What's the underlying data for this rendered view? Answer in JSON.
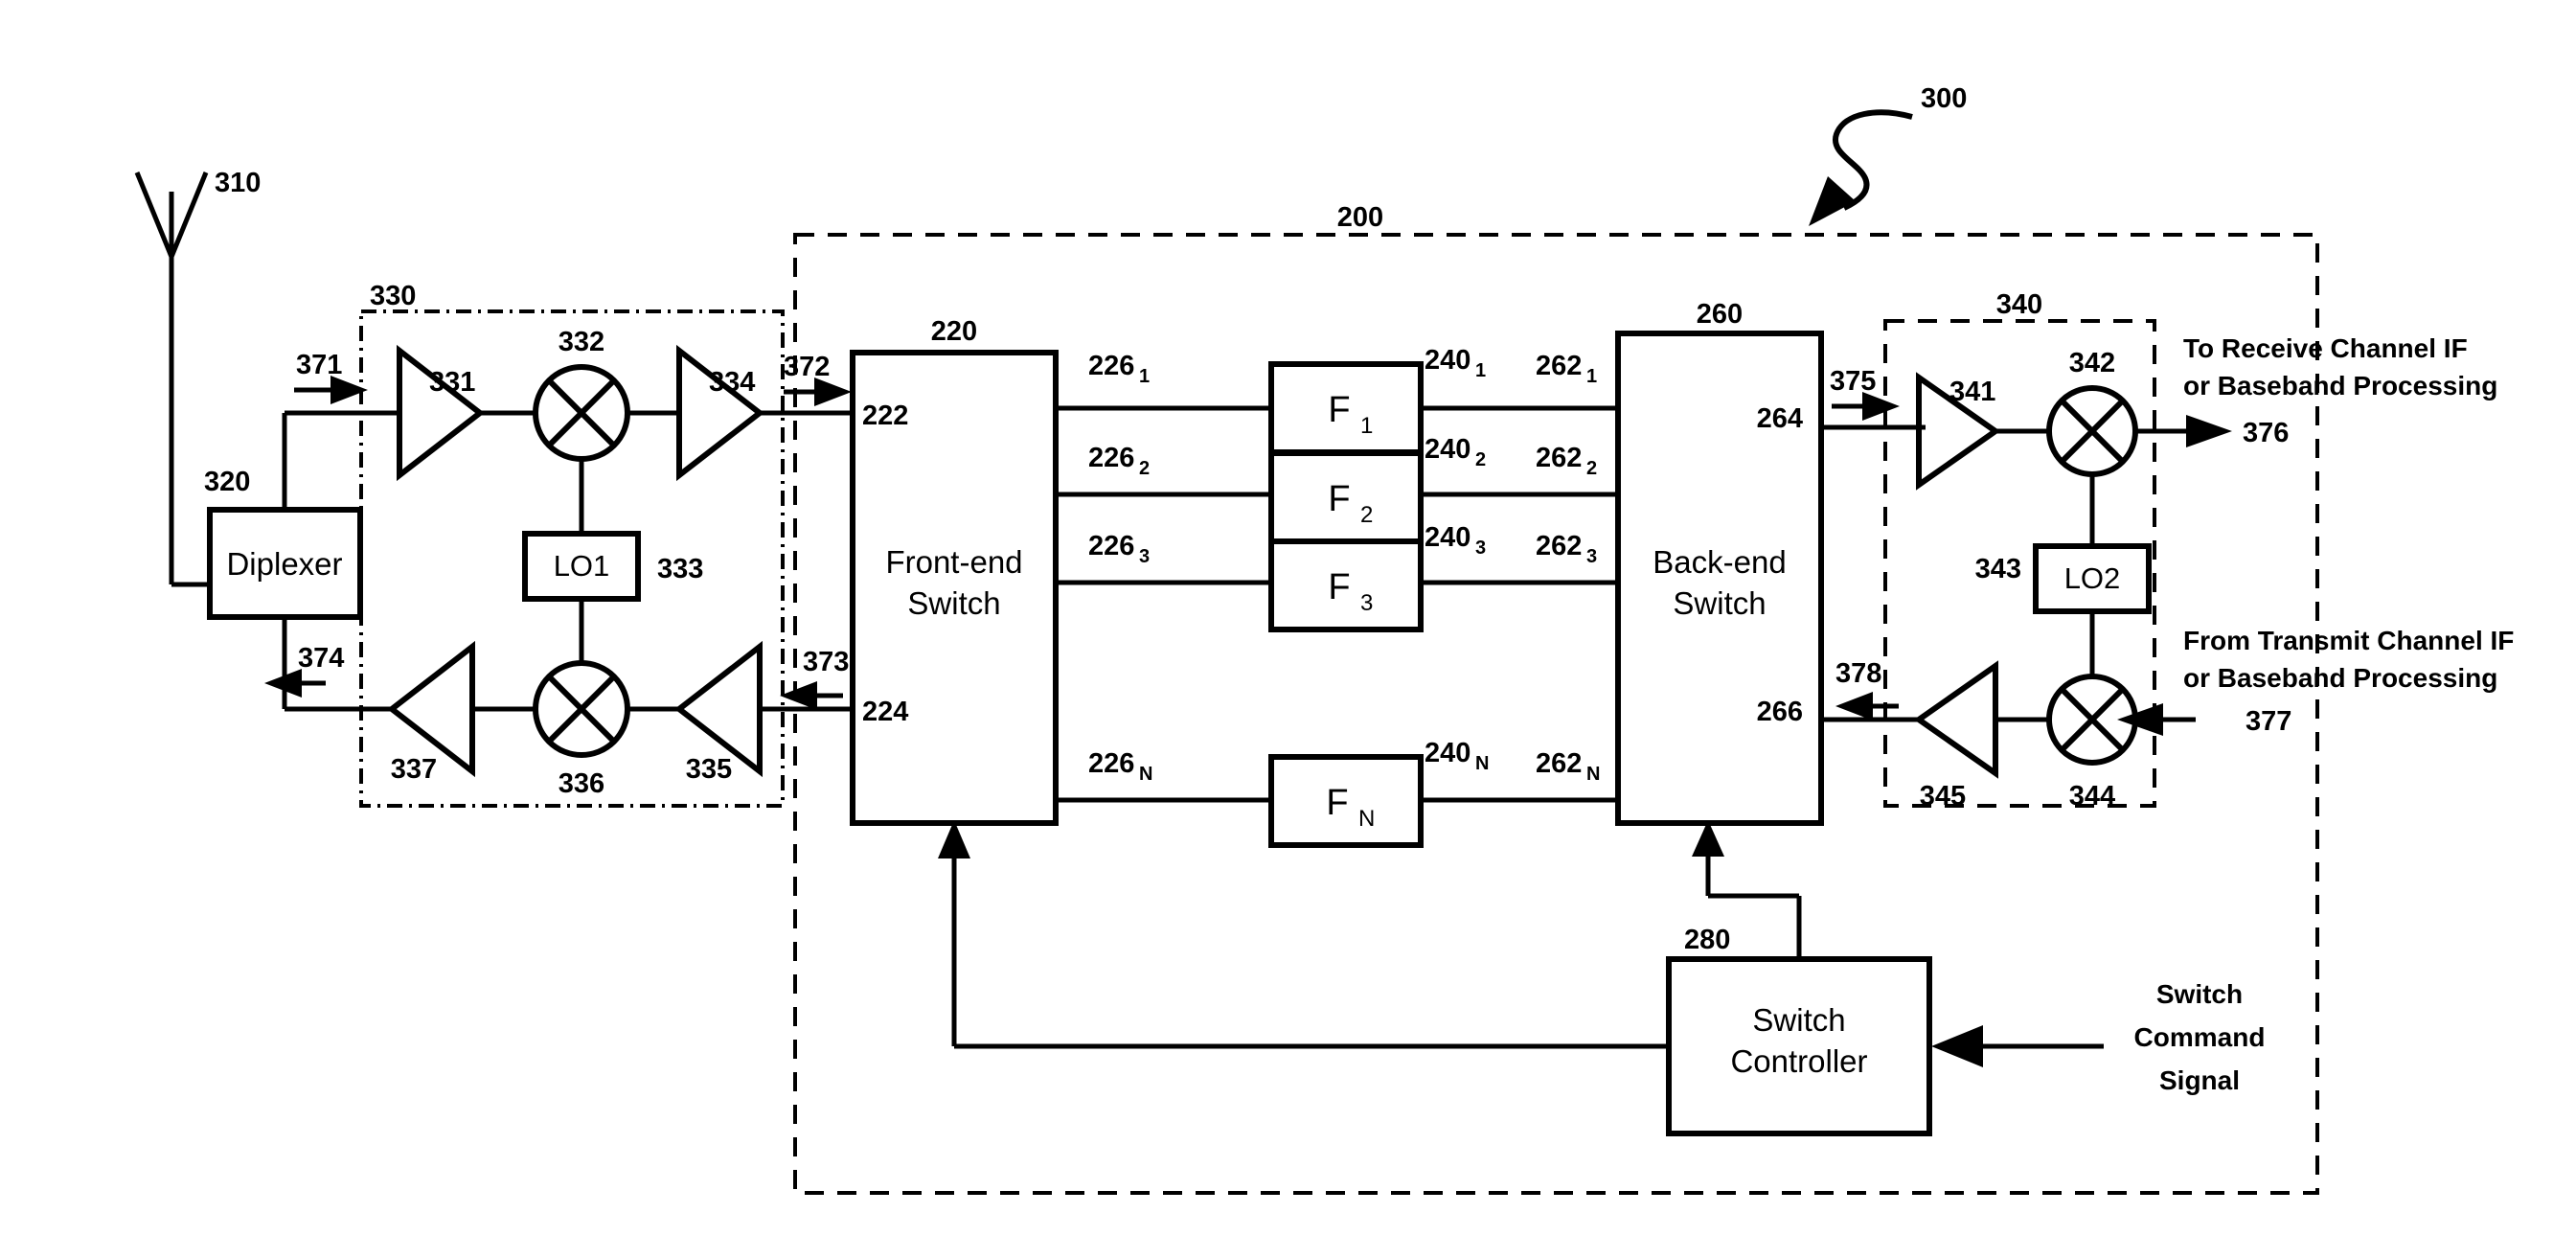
{
  "figure": {
    "number": "300",
    "type": "patent-block-diagram"
  },
  "chart_data": {
    "type": "diagram",
    "title": "Switched-filter transceiver block diagram",
    "figure_number": "300"
  },
  "antenna": {
    "ref": "310"
  },
  "diplexer": {
    "label": "Diplexer",
    "ref": "320"
  },
  "frontend_rf": {
    "ref": "330",
    "rx_amp_1": "331",
    "rx_mixer": "332",
    "lo1_ref": "333",
    "lo1_label": "LO1",
    "rx_amp_2": "334",
    "tx_amp_1": "335",
    "tx_mixer": "336",
    "tx_amp_2": "337"
  },
  "signals": {
    "s371": "371",
    "s372": "372",
    "s373": "373",
    "s374": "374",
    "s375": "375",
    "s376": "376",
    "s377": "377",
    "s378": "378"
  },
  "switch_module": {
    "ref": "200"
  },
  "front_end_switch": {
    "ref": "220",
    "label_line1": "Front-end",
    "label_line2": "Switch",
    "port_in": "222",
    "port_out": "224"
  },
  "back_end_switch": {
    "ref": "260",
    "label_line1": "Back-end",
    "label_line2": "Switch",
    "port_out": "264",
    "port_in": "266"
  },
  "switch_controller": {
    "ref": "280",
    "label_line1": "Switch",
    "label_line2": "Controller",
    "command_line1": "Switch",
    "command_line2": "Command",
    "command_line3": "Signal"
  },
  "filters": [
    {
      "name": "F",
      "sub": "1",
      "in_ref": "226",
      "in_sub": "1",
      "out_ref": "240",
      "out_sub": "1",
      "be_ref": "262",
      "be_sub": "1"
    },
    {
      "name": "F",
      "sub": "2",
      "in_ref": "226",
      "in_sub": "2",
      "out_ref": "240",
      "out_sub": "2",
      "be_ref": "262",
      "be_sub": "2"
    },
    {
      "name": "F",
      "sub": "3",
      "in_ref": "226",
      "in_sub": "3",
      "out_ref": "240",
      "out_sub": "3",
      "be_ref": "262",
      "be_sub": "3"
    },
    {
      "name": "F",
      "sub": "N",
      "in_ref": "226",
      "in_sub": "N",
      "out_ref": "240",
      "out_sub": "N",
      "be_ref": "262",
      "be_sub": "N"
    }
  ],
  "backend_rf": {
    "ref": "340",
    "rx_amp": "341",
    "rx_mixer": "342",
    "lo2_ref": "343",
    "lo2_label": "LO2",
    "tx_mixer": "344",
    "tx_amp": "345"
  },
  "io_notes": {
    "receive_line1": "To Receive Channel IF",
    "receive_line2": "or Baseband Processing",
    "transmit_line1": "From Transmit Channel IF",
    "transmit_line2": "or Baseband Processing"
  },
  "colors": {
    "ink": "#000000",
    "paper": "#ffffff"
  }
}
